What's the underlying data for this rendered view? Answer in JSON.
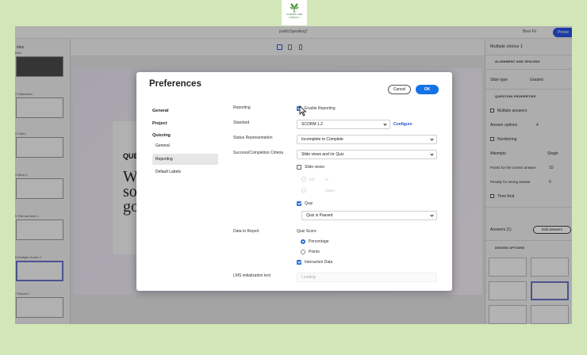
{
  "logo": {
    "line1": "SCIENCE AND",
    "line2": "LITERACY"
  },
  "app": {
    "filename": "publicSpeaking*",
    "zoom": "Best Fit",
    "preview_label": "Previe",
    "slides_header": "ides",
    "slides": [
      {
        "label": "Intro",
        "style": "dark"
      },
      {
        "label": "2 Objectives",
        "style": "light"
      },
      {
        "label": "3 Video",
        "style": "light"
      },
      {
        "label": "4 Book 1",
        "style": "light"
      },
      {
        "label": "5 Title and text 1",
        "style": "light"
      },
      {
        "label": "6 Multiple choice 1",
        "style": "sel"
      },
      {
        "label": "7 Result 1",
        "style": "light"
      }
    ],
    "slide": {
      "question": "QUES",
      "big_text": "Wh\nsor\ngoi"
    },
    "right_panel": {
      "title": "Multiple choice 1",
      "alignment_spacing": "ALIGNMENT AND SPACING",
      "slide_type_label": "Slide type",
      "slide_type_value": "Graded",
      "question_properties": "QUESTION PROPERTIES",
      "multiple_answers": "Multiple answers",
      "answer_options": "Answer options",
      "answer_options_value": "4",
      "numbering": "Numbering",
      "attempts": "Attempts",
      "attempts_value": "Single",
      "points_correct": "Points for the correct answer",
      "points_correct_value": "10",
      "penalty_wrong": "Penalty for wrong answer",
      "penalty_wrong_value": "0",
      "time_limit": "Time limit",
      "answers": "Answers (1)",
      "edit_answers": "Edit answers",
      "design_options": "DESIGN OPTIONS"
    }
  },
  "dialog": {
    "title": "Preferences",
    "cancel_label": "Cancel",
    "ok_label": "OK",
    "categories": {
      "general": "General",
      "project": "Project",
      "quizzing": "Quizzing",
      "sub_general": "General",
      "reporting": "Reporting",
      "default_labels": "Default Labels"
    },
    "fields": {
      "reporting_label": "Reporting",
      "enable_reporting": "Enable Reporting",
      "standard_label": "Standard",
      "standard_value": "SCORM 1.2",
      "configure": "Configure",
      "status_label": "Status Representation",
      "status_value": "Incomplete to Complete",
      "criteria_label": "Success/Completion Criteria",
      "criteria_value": "Slide views and /or Quiz",
      "slide_views": "Slide views",
      "slide_views_num": "100",
      "slide_views_pct": "%",
      "slides_option": "Slides",
      "quiz": "Quiz",
      "quiz_value": "Quiz is Passed",
      "data_report_label": "Data to Report",
      "quiz_score": "Quiz Score",
      "percentage": "Percentage",
      "points": "Points",
      "interaction_data": "Interaction Data",
      "lms_label": "LMS initialization text",
      "lms_value": "Loading"
    }
  },
  "colors": {
    "accent": "#1473e6",
    "checkbox": "#2d6fd6",
    "link": "#2b55c8",
    "background": "#d2e6b8"
  }
}
